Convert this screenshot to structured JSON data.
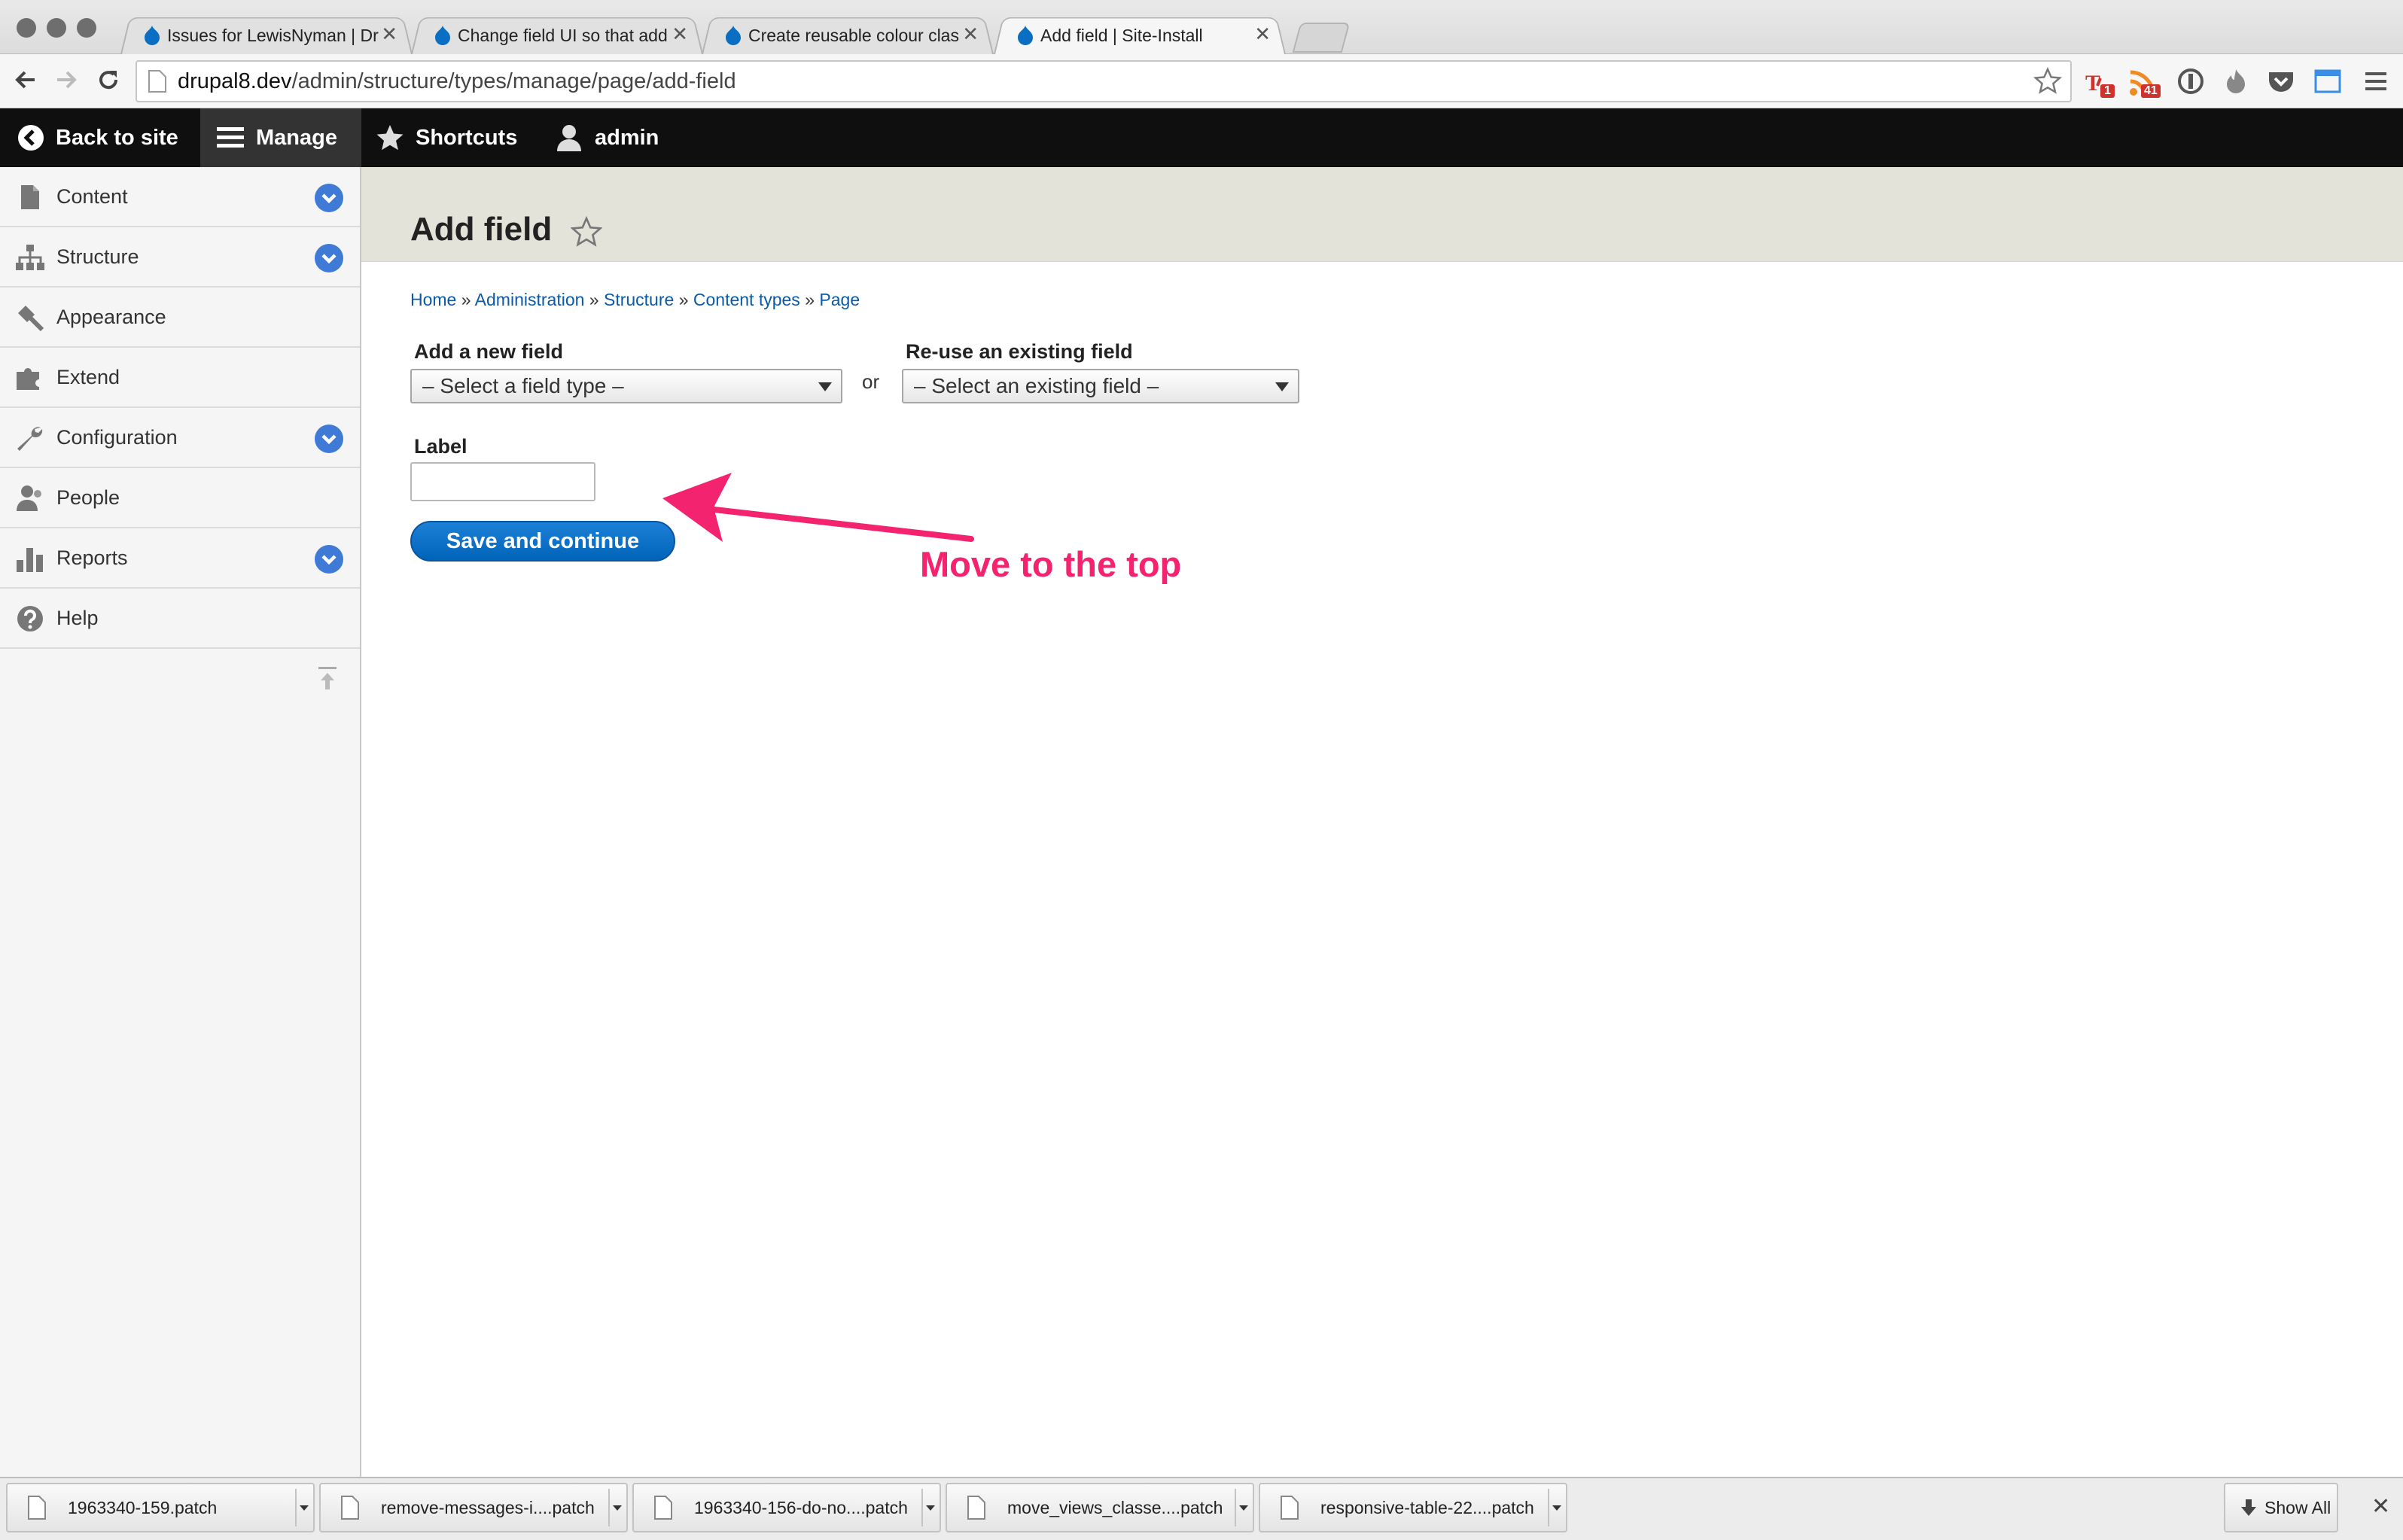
{
  "browser": {
    "tabs": [
      {
        "title": "Issues for LewisNyman | Dr",
        "active": false
      },
      {
        "title": "Change field UI so that add",
        "active": false
      },
      {
        "title": "Create reusable colour clas",
        "active": false
      },
      {
        "title": "Add field | Site-Install",
        "active": true
      }
    ],
    "tab_close": "✕",
    "url_host": "drupal8.dev",
    "url_path": "/admin/structure/types/manage/page/add-field",
    "extension_badges": {
      "todo": "1",
      "rss": "41"
    }
  },
  "drupal_toolbar": {
    "back_to_site": "Back to site",
    "manage": "Manage",
    "shortcuts": "Shortcuts",
    "user": "admin"
  },
  "sidebar": {
    "items": [
      {
        "label": "Content",
        "icon": "file-icon",
        "expandable": true
      },
      {
        "label": "Structure",
        "icon": "sitemap-icon",
        "expandable": true
      },
      {
        "label": "Appearance",
        "icon": "paintbrush-icon",
        "expandable": false
      },
      {
        "label": "Extend",
        "icon": "puzzle-icon",
        "expandable": false
      },
      {
        "label": "Configuration",
        "icon": "wrench-icon",
        "expandable": true
      },
      {
        "label": "People",
        "icon": "people-icon",
        "expandable": false
      },
      {
        "label": "Reports",
        "icon": "bar-chart-icon",
        "expandable": true
      },
      {
        "label": "Help",
        "icon": "help-icon",
        "expandable": false
      }
    ]
  },
  "page": {
    "title": "Add field",
    "breadcrumb": [
      "Home",
      "Administration",
      "Structure",
      "Content types",
      "Page"
    ],
    "breadcrumb_sep": "»",
    "form": {
      "new_field_label": "Add a new field",
      "new_field_select": "– Select a field type –",
      "or": "or",
      "existing_field_label": "Re-use an existing field",
      "existing_field_select": "– Select an existing field –",
      "label_label": "Label",
      "label_value": "",
      "save_button": "Save and continue"
    },
    "annotation": "Move to the top"
  },
  "downloads": {
    "items": [
      "1963340-159.patch",
      "remove-messages-i....patch",
      "1963340-156-do-no....patch",
      "move_views_classe....patch",
      "responsive-table-22....patch"
    ],
    "show_all": "Show All",
    "close": "✕"
  },
  "colors": {
    "drupal_toolbar": "#0f0f0f",
    "link": "#0a5aa8",
    "button": "#0064b9",
    "chevron": "#3e7ad6",
    "annotation": "#f3236f"
  }
}
